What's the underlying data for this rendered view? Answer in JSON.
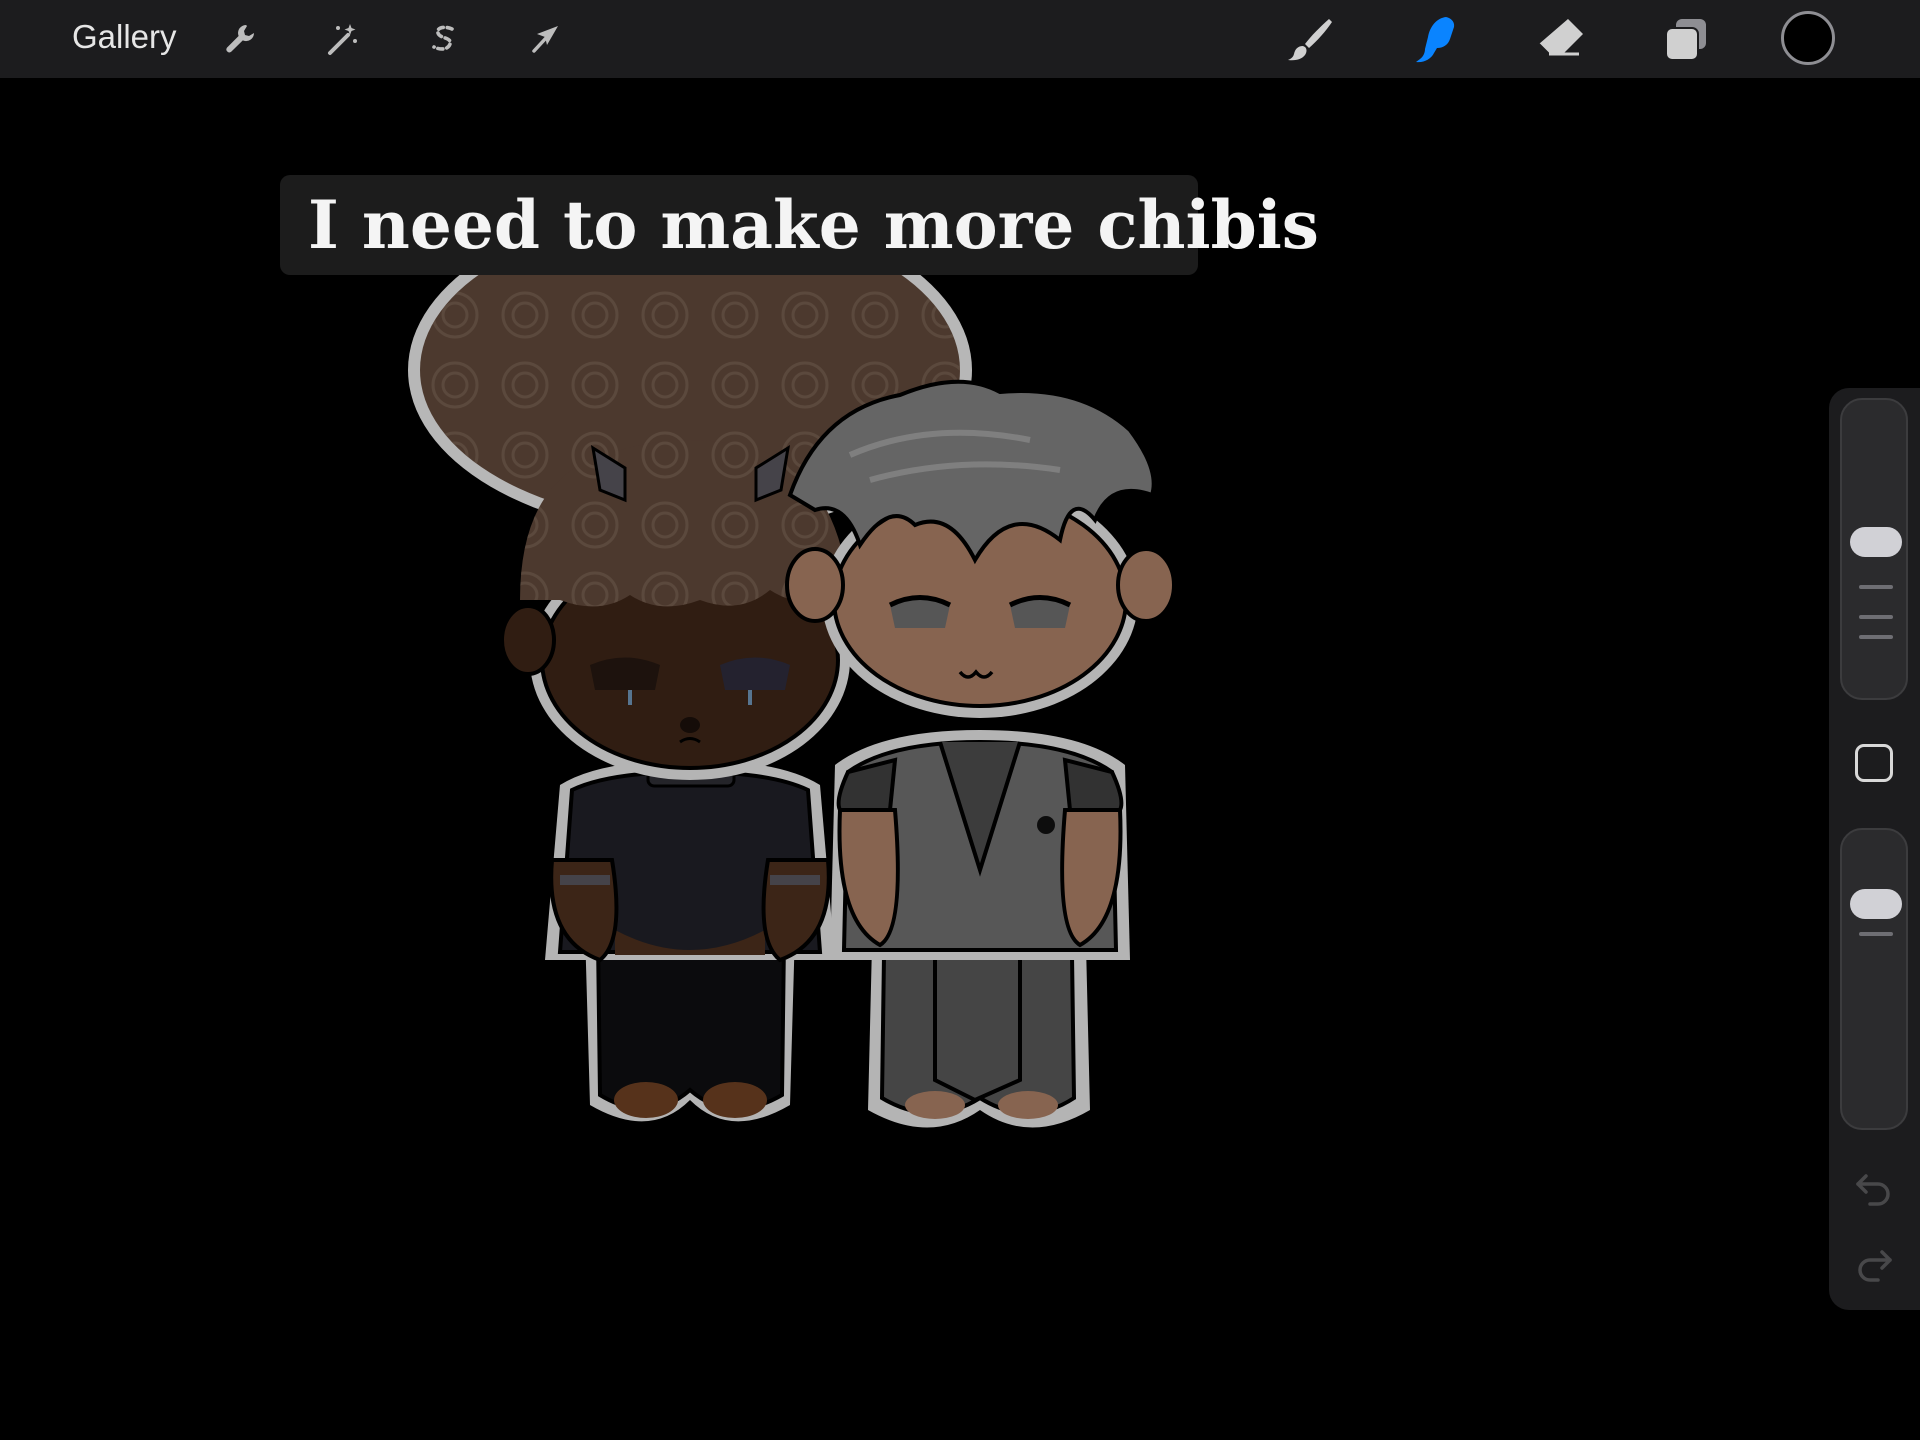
{
  "toolbar": {
    "gallery_label": "Gallery",
    "left_tools": [
      {
        "name": "actions",
        "icon": "wrench-icon"
      },
      {
        "name": "adjustments",
        "icon": "magic-wand-icon"
      },
      {
        "name": "selection",
        "icon": "selection-s-icon"
      },
      {
        "name": "transform",
        "icon": "arrow-cursor-icon"
      }
    ],
    "right_tools": [
      {
        "name": "brush",
        "icon": "brush-icon",
        "active": false
      },
      {
        "name": "smudge",
        "icon": "smudge-finger-icon",
        "active": true
      },
      {
        "name": "eraser",
        "icon": "eraser-icon",
        "active": false
      },
      {
        "name": "layers",
        "icon": "layers-icon",
        "active": false
      }
    ],
    "current_color": "#000000",
    "active_color": "#0a84ff"
  },
  "canvas": {
    "caption": "I need to make more chibis",
    "background": "#000000"
  },
  "sidebar": {
    "brush_size_level": 0.45,
    "opacity_level": 0.2,
    "icons": [
      "modify-square-icon",
      "undo-icon",
      "redo-icon"
    ]
  }
}
